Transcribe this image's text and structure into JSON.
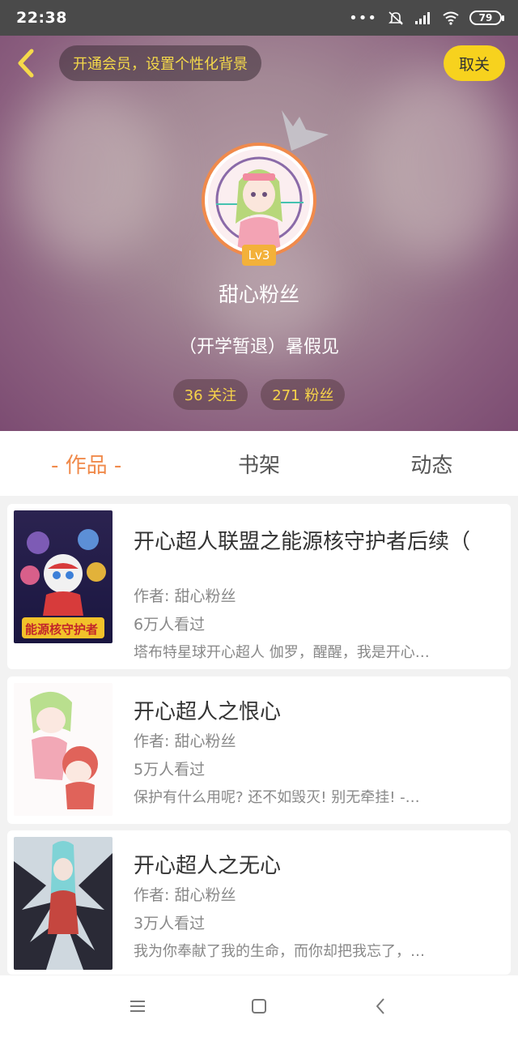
{
  "status_bar": {
    "time": "22:38",
    "battery": "79",
    "icons": [
      "more-dots-icon",
      "bell-off-icon",
      "signal-icon",
      "wifi-icon",
      "battery-icon"
    ]
  },
  "header": {
    "vip_banner": "开通会员，设置个性化背景",
    "unfollow_label": "取关",
    "level": "Lv3",
    "username": "甜心粉丝",
    "bio": "（开学暂退）暑假见",
    "following": "36 关注",
    "followers": "271 粉丝"
  },
  "tabs": [
    {
      "label": "- 作品 -",
      "active": true
    },
    {
      "label": "书架",
      "active": false
    },
    {
      "label": "动态",
      "active": false
    }
  ],
  "works": [
    {
      "title": "开心超人联盟之能源核守护者后续（",
      "author": "作者: 甜心粉丝",
      "views": "6万人看过",
      "desc": "塔布特星球开心超人 伽罗，醒醒，我是开心…",
      "cover_text": "能源核守护者"
    },
    {
      "title": "开心超人之恨心",
      "author": "作者: 甜心粉丝",
      "views": "5万人看过",
      "desc": "保护有什么用呢? 还不如毁灭! 别无牵挂! -…"
    },
    {
      "title": "开心超人之无心",
      "author": "作者: 甜心粉丝",
      "views": "3万人看过",
      "desc": "我为你奉献了我的生命，而你却把我忘了，…"
    }
  ],
  "colors": {
    "accent": "#f08a4b",
    "highlight": "#f7d21e",
    "header": "#9a7488"
  }
}
